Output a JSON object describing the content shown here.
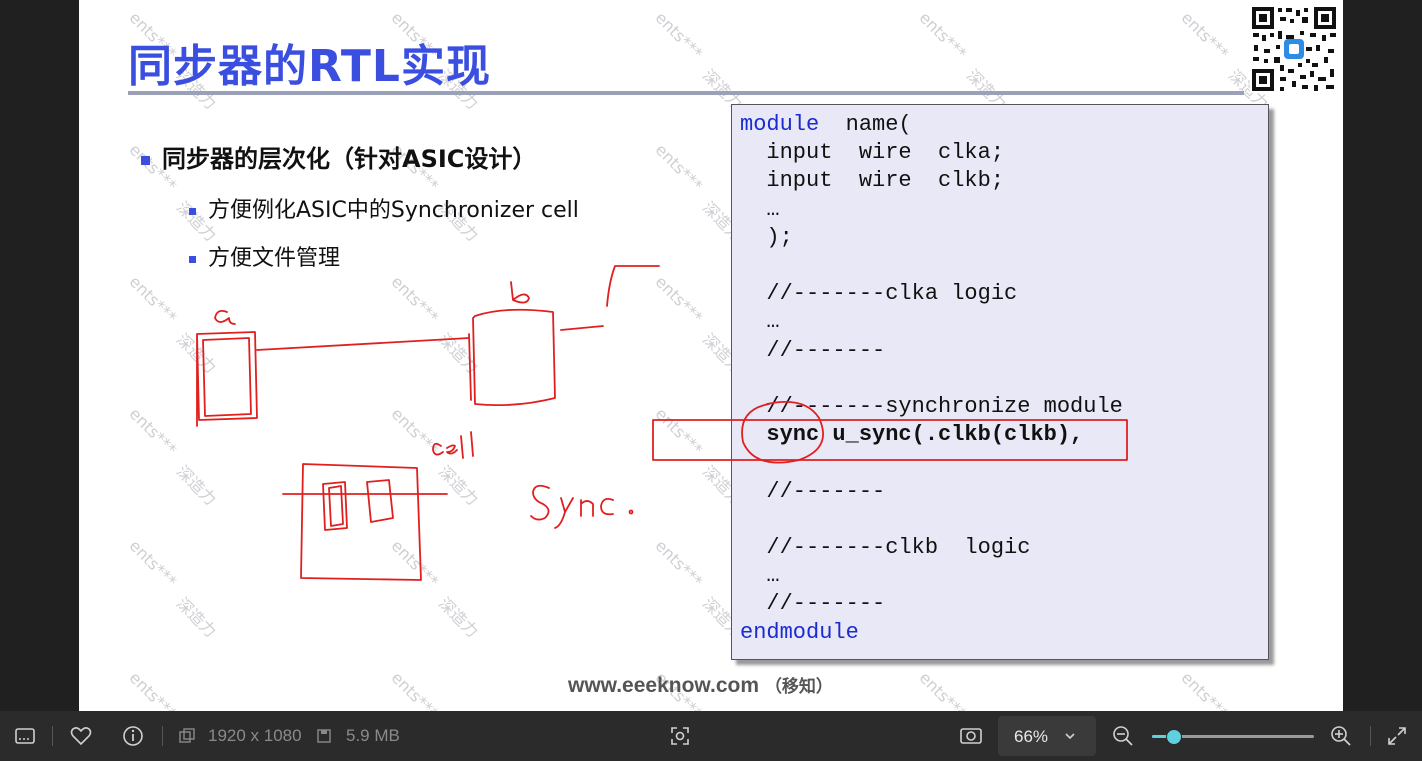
{
  "slide": {
    "title": "同步器的RTL实现",
    "bullets": [
      "同步器的层次化（针对ASIC设计）",
      "方便例化ASIC中的Synchronizer cell",
      "方便文件管理"
    ],
    "code_lines": [
      {
        "kw": "module",
        "rest": "  name("
      },
      {
        "kw": "",
        "rest": "  input  wire  clka;"
      },
      {
        "kw": "",
        "rest": "  input  wire  clkb;"
      },
      {
        "kw": "",
        "rest": "  …"
      },
      {
        "kw": "",
        "rest": "  );"
      },
      {
        "kw": "",
        "rest": ""
      },
      {
        "kw": "",
        "rest": "  //-------clka logic"
      },
      {
        "kw": "",
        "rest": "  …"
      },
      {
        "kw": "",
        "rest": "  //-------"
      },
      {
        "kw": "",
        "rest": ""
      },
      {
        "kw": "",
        "rest": "  //-------synchronize module"
      },
      {
        "kw": "",
        "rest": "  sync u_sync(.clkb(clkb),",
        "bold": true
      },
      {
        "kw": "",
        "rest": ""
      },
      {
        "kw": "",
        "rest": "  //-------"
      },
      {
        "kw": "",
        "rest": ""
      },
      {
        "kw": "",
        "rest": "  //-------clkb  logic"
      },
      {
        "kw": "",
        "rest": "  …"
      },
      {
        "kw": "",
        "rest": "  //-------"
      },
      {
        "kw": "endmodule",
        "rest": ""
      }
    ],
    "footer_url": "www.eeeknow.com",
    "footer_cn": "（移知）",
    "watermark_a": "ents***",
    "watermark_b": "深造力",
    "handwriting": {
      "a": "a",
      "b": "b",
      "cell": "cell",
      "sync": "Sync."
    }
  },
  "toolbar": {
    "dimensions": "1920 x 1080",
    "file_size": "5.9 MB",
    "zoom": "66%",
    "zoom_fraction": 0.13
  },
  "colors": {
    "title": "#3a4fe0",
    "keyword": "#1a2bd0",
    "ink": "#e02020",
    "code_bg": "#e8e8f6",
    "slider": "#5fd0de"
  }
}
